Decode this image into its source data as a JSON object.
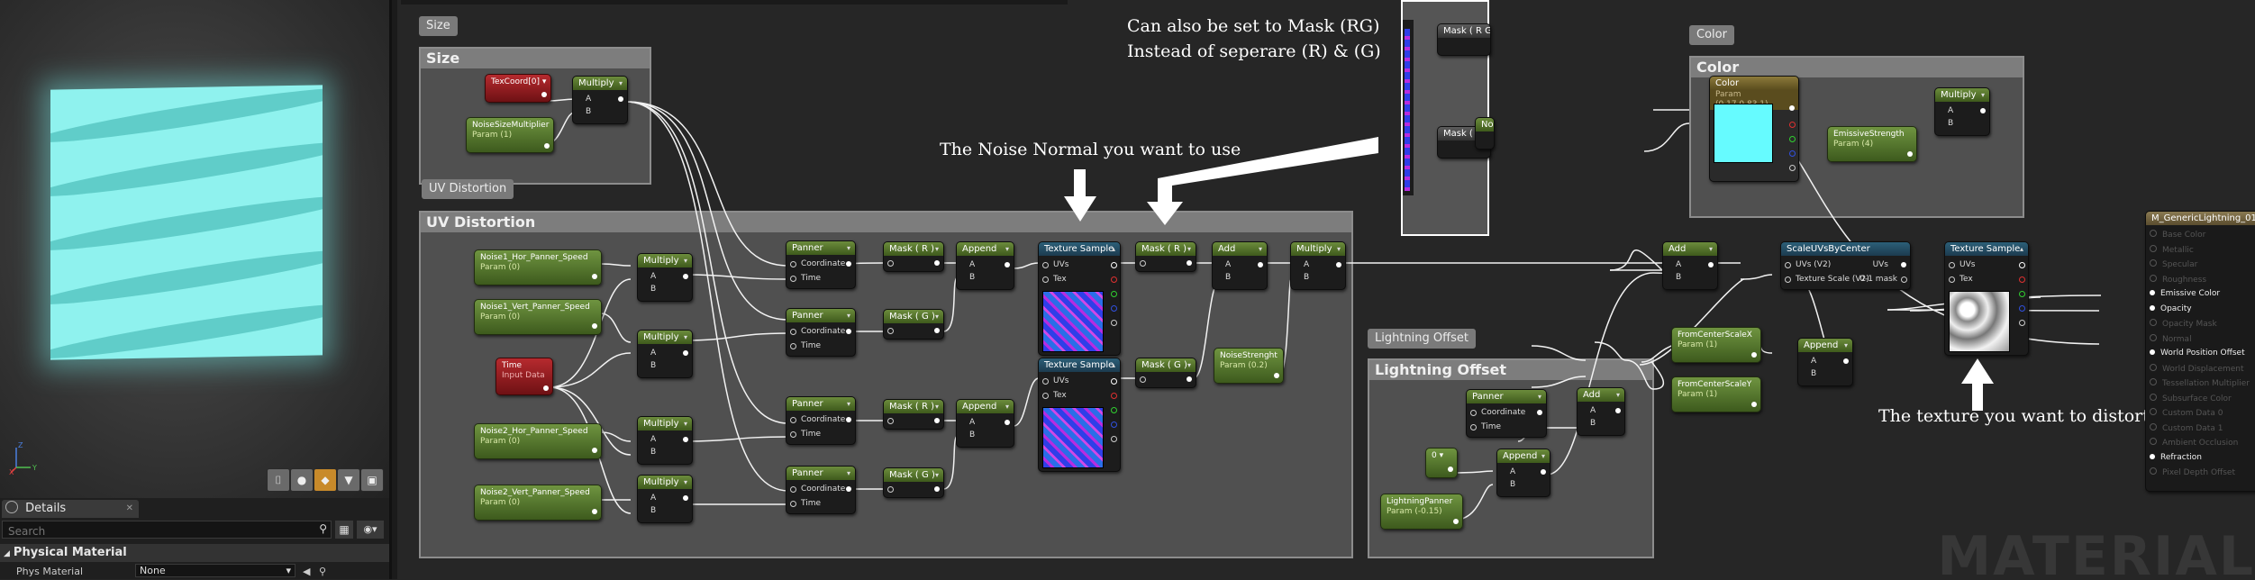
{
  "viewport": {
    "axes": {
      "x": "X",
      "y": "Y",
      "z": "Z"
    },
    "buttons": [
      "cylinder",
      "sphere",
      "plane",
      "cube",
      "custom"
    ]
  },
  "details": {
    "tab_label": "Details",
    "search_placeholder": "Search",
    "category": "Physical Material",
    "property_label": "Phys Material",
    "property_value": "None"
  },
  "comments": {
    "size": "Size",
    "uv_distortion": "UV Distortion",
    "color": "Color",
    "lightning_offset": "Lightning Offset"
  },
  "notes": {
    "mask_line1": "Can also be set to Mask (RG)",
    "mask_line2": "Instead of seperare (R) & (G)",
    "noise_normal": "The Noise Normal you want to use",
    "texture_distort": "The texture you want to distort"
  },
  "nodes": {
    "texcoord": "TexCoord[0]",
    "multiply": "Multiply",
    "noise_size_multiplier": {
      "name": "NoiseSizeMultiplier",
      "sub": "Param (1)"
    },
    "noise1_hor": {
      "name": "Noise1_Hor_Panner_Speed",
      "sub": "Param (0)"
    },
    "noise1_vert": {
      "name": "Noise1_Vert_Panner_Speed",
      "sub": "Param (0)"
    },
    "time": {
      "name": "Time",
      "sub": "Input Data"
    },
    "noise2_hor": {
      "name": "Noise2_Hor_Panner_Speed",
      "sub": "Param (0)"
    },
    "noise2_vert": {
      "name": "Noise2_Vert_Panner_Speed",
      "sub": "Param (0)"
    },
    "panner": "Panner",
    "coordinate": "Coordinate",
    "time_pin": "Time",
    "mask_r": "Mask ( R )",
    "mask_g": "Mask ( G )",
    "append": "Append",
    "texture_sample": "Texture Sample",
    "uvs": "UVs",
    "tex": "Tex",
    "add": "Add",
    "noise_strenght": {
      "name": "NoiseStrenght",
      "sub": "Param (0.2)"
    },
    "pin_a": "A",
    "pin_b": "B",
    "color_param": {
      "name": "Color",
      "sub": "Param (0.17,0.83,1)"
    },
    "emissive_strength": {
      "name": "EmissiveStrength",
      "sub": "Param (4)"
    },
    "scale_uvs": "ScaleUVsByCenter",
    "uvs_v2": "UVs (V2)",
    "texture_scale": "Texture Scale (V2)",
    "mask_01": "0-1 mask",
    "from_center_x": {
      "name": "FromCenterScaleX",
      "sub": "Param (1)"
    },
    "from_center_y": {
      "name": "FromCenterScaleY",
      "sub": "Param (1)"
    },
    "zero": "0",
    "lightning_panner": {
      "name": "LightningPanner",
      "sub": "Param (-0.15)"
    },
    "mask_rg_a": "Mask ( R G )",
    "noise_short": "Noise"
  },
  "material_output": {
    "title": "M_GenericLightning_01",
    "pins": [
      {
        "label": "Base Color",
        "active": false
      },
      {
        "label": "Metallic",
        "active": false
      },
      {
        "label": "Specular",
        "active": false
      },
      {
        "label": "Roughness",
        "active": false
      },
      {
        "label": "Emissive Color",
        "active": true
      },
      {
        "label": "Opacity",
        "active": true
      },
      {
        "label": "Opacity Mask",
        "active": false
      },
      {
        "label": "Normal",
        "active": false
      },
      {
        "label": "World Position Offset",
        "active": true
      },
      {
        "label": "World Displacement",
        "active": false
      },
      {
        "label": "Tessellation Multiplier",
        "active": false
      },
      {
        "label": "Subsurface Color",
        "active": false
      },
      {
        "label": "Custom Data 0",
        "active": false
      },
      {
        "label": "Custom Data 1",
        "active": false
      },
      {
        "label": "Ambient Occlusion",
        "active": false
      },
      {
        "label": "Refraction",
        "active": true
      },
      {
        "label": "Pixel Depth Offset",
        "active": false
      }
    ]
  },
  "watermark": "MATERIAL"
}
